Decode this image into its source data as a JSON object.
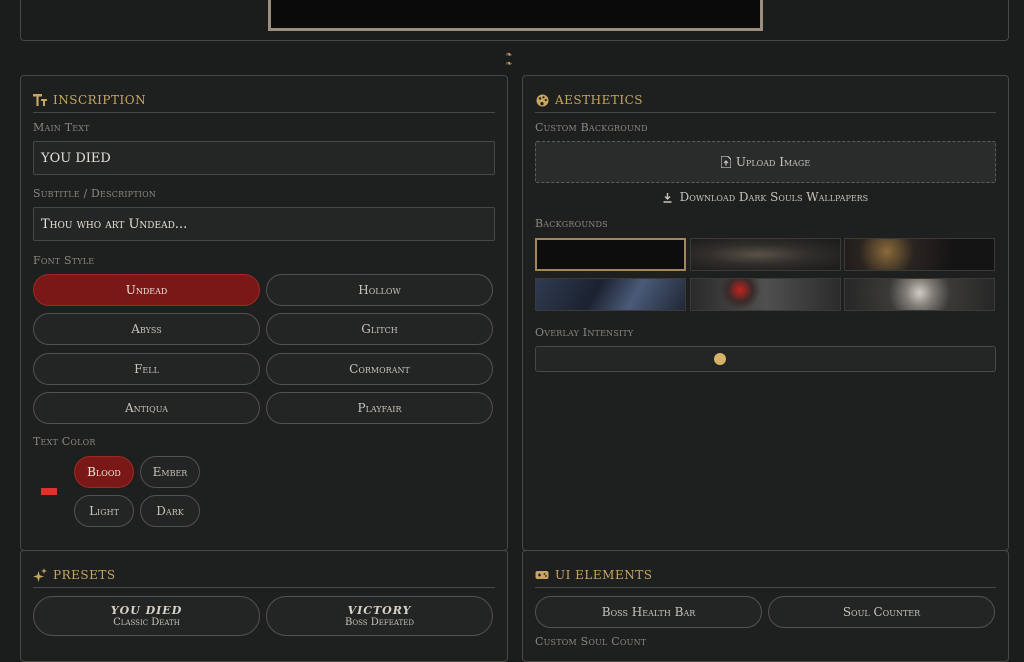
{
  "divider": {
    "ornament": "❧ ❧"
  },
  "inscription": {
    "title": "Inscription",
    "main_text_label": "Main Text",
    "main_text_value": "YOU DIED",
    "subtitle_label": "Subtitle / Description",
    "subtitle_value": "Thou who art Undead...",
    "font_style_label": "Font Style",
    "fonts": [
      "Undead",
      "Hollow",
      "Abyss",
      "Glitch",
      "Fell",
      "Cormorant",
      "Antiqua",
      "Playfair"
    ],
    "active_font": "Undead",
    "text_color_label": "Text Color",
    "swatch_color": "#e2302c",
    "colors": [
      "Blood",
      "Ember",
      "Light",
      "Dark"
    ],
    "active_color": "Blood"
  },
  "aesthetics": {
    "title": "Aesthetics",
    "custom_bg_label": "Custom Background",
    "upload_label": "Upload Image",
    "download_label": "Download Dark Souls Wallpapers",
    "backgrounds_label": "Backgrounds",
    "overlay_label": "Overlay Intensity",
    "overlay_value": 0.4
  },
  "presets": {
    "title": "Presets",
    "items": [
      {
        "title": "YOU DIED",
        "sub": "Classic Death"
      },
      {
        "title": "VICTORY",
        "sub": "Boss Defeated"
      }
    ]
  },
  "ui_elements": {
    "title": "UI Elements",
    "buttons": [
      "Boss Health Bar",
      "Soul Counter"
    ],
    "next_label": "Custom Soul Count"
  },
  "colors": {
    "accent_gold": "#c9a65f",
    "blood": "#7a1818"
  }
}
